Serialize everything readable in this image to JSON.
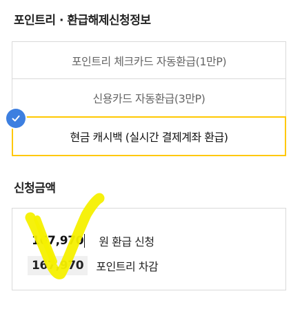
{
  "section1": {
    "title": "포인트리 · 환급해제신청정보",
    "options": [
      {
        "label": "포인트리 체크카드 자동환급(1만P)",
        "selected": false
      },
      {
        "label": "신용카드 자동환급(3만P)",
        "selected": false
      },
      {
        "label": "현금 캐시백 (실시간 결제계좌 환급)",
        "selected": true
      }
    ]
  },
  "section2": {
    "title": "신청금액",
    "amount_input_value": "167,970",
    "amount_suffix": "원 환급 신청",
    "deduct_value": "167,970",
    "deduct_label": "포인트리 차감"
  },
  "colors": {
    "selected_border": "#ffc800",
    "check_badge": "#3d7fe0",
    "highlighter": "#f5f000"
  },
  "icons": [
    "checkmark-icon"
  ]
}
